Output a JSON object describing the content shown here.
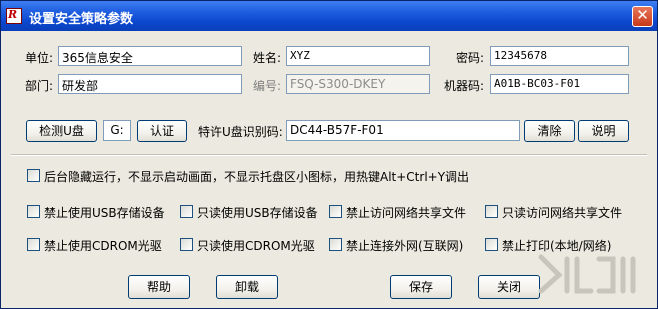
{
  "window": {
    "title": "设置安全策略参数",
    "app_icon": "ransom-style-icon",
    "close_glyph": "✕"
  },
  "info": {
    "unit_label": "单位:",
    "unit_value": "365信息安全",
    "name_label": "姓名:",
    "name_value": "XYZ",
    "password_label": "密码:",
    "password_value": "12345678",
    "dept_label": "部门:",
    "dept_value": "研发部",
    "code_label": "编号:",
    "code_value": "FSQ-S300-DKEY",
    "machine_label": "机器码:",
    "machine_value": "A01B-BC03-F01"
  },
  "usb": {
    "detect_label": "检测U盘",
    "drive_value": "G:",
    "auth_label": "认证",
    "id_label": "特许U盘识别码:",
    "id_value": "DC44-B57F-F01",
    "clear_label": "清除",
    "help_label": "说明"
  },
  "options": {
    "background_run": "后台隐藏运行，不显示启动画面，不显示托盘区小图标，用热键Alt+Ctrl+Y调出",
    "row1": [
      "禁止使用USB存储设备",
      "只读使用USB存储设备",
      "禁止访问网络共享文件",
      "只读访问网络共享文件"
    ],
    "row2": [
      "禁止使用CDROM光驱",
      "只读使用CDROM光驱",
      "禁止连接外网(互联网)",
      "禁止打印(本地/网络)"
    ]
  },
  "footer": {
    "help": "帮助",
    "uninstall": "卸载",
    "save": "保存",
    "close": "关闭"
  }
}
